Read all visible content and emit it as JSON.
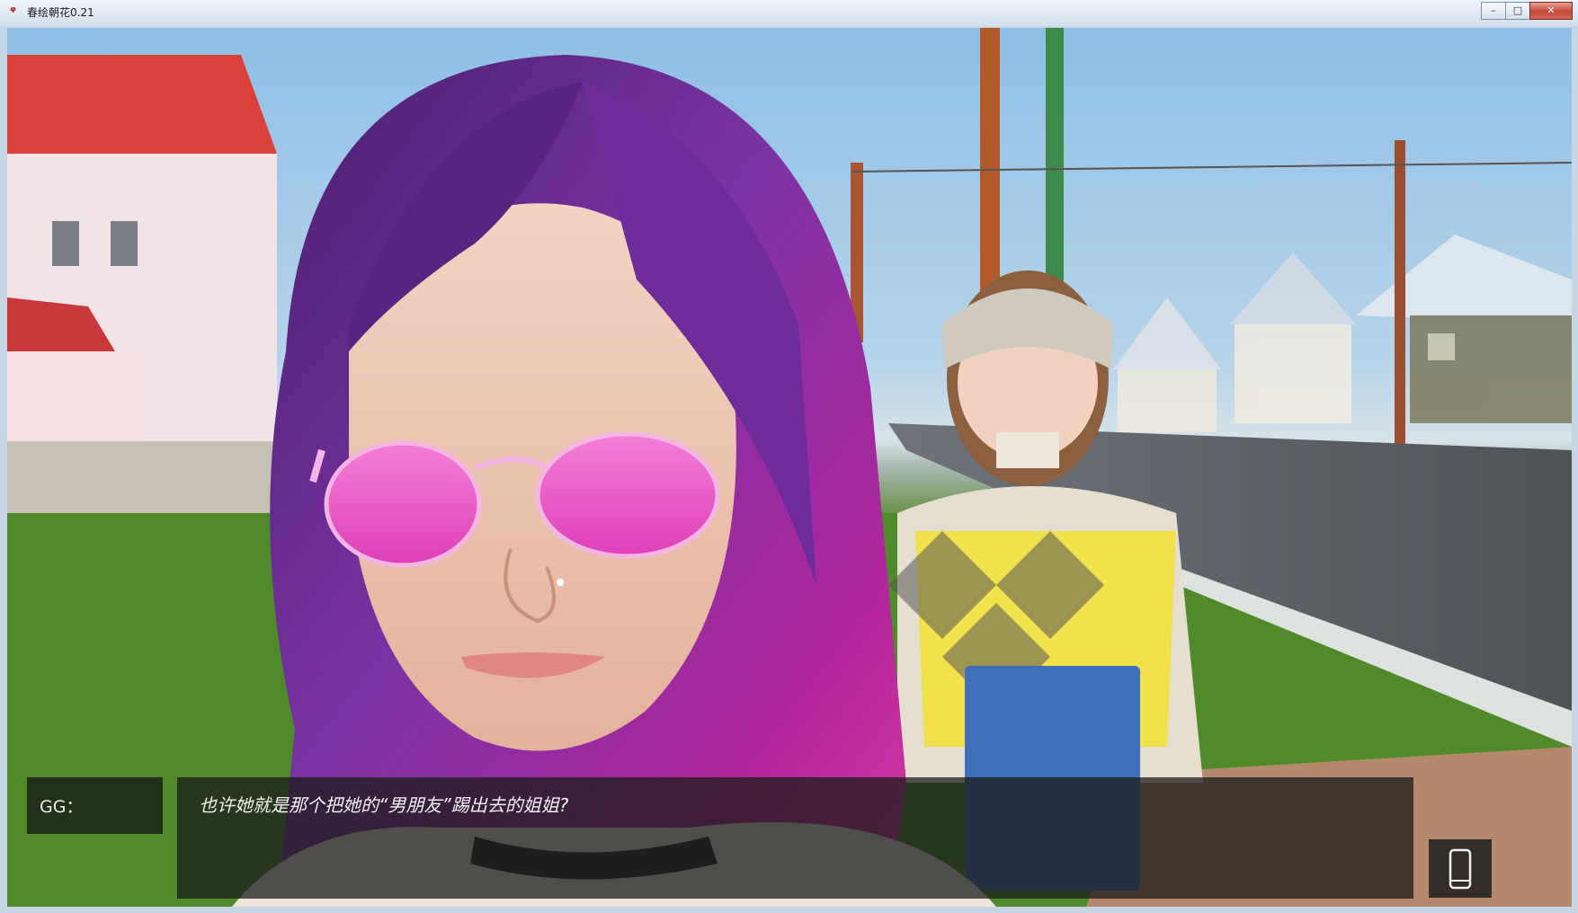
{
  "window": {
    "title": "春绘朝花0.21",
    "minimize_symbol": "–",
    "maximize_symbol": "□",
    "close_symbol": "✕"
  },
  "dialogue": {
    "speaker": "GG：",
    "text": "也许她就是那个把她的“男朋友”踢出去的姐姐?"
  },
  "phone_button": {
    "icon": "phone-icon"
  },
  "colors": {
    "hair": "#6b2a8c",
    "sunglasses": "#e05bc8",
    "sky": "#8fbfe6",
    "grass": "#4f8a2b",
    "dialogue_bg": "#181a18"
  }
}
